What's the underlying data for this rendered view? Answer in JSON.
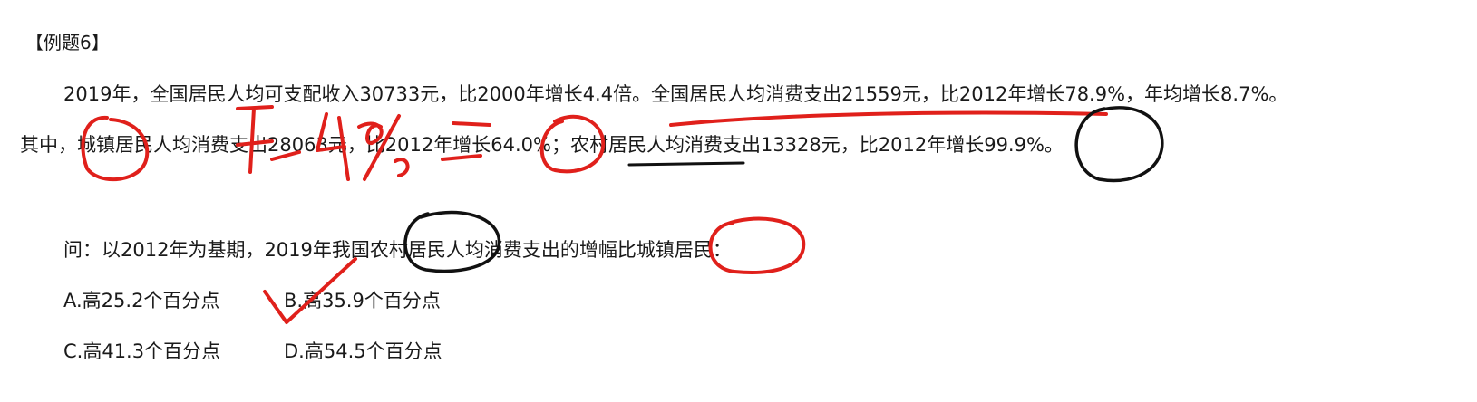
{
  "problem": {
    "title": "【例题6】",
    "paragraph1": "2019年，全国居民人均可支配收入30733元，比2000年增长4.4倍。全国居民人均消费支出21559元，比2012年增长78.9%，年均增长8.7%。",
    "paragraph2": "其中，城镇居民人均消费支出28063元，比2012年增长64.0%；农村居民人均消费支出13328元，比2012年增长99.9%。",
    "question": "问：以2012年为基期，2019年我国农村居民人均消费支出的增幅比城镇居民：",
    "options": {
      "a": "A.高25.2个百分点",
      "b": "B.高35.9个百分点",
      "c": "C.高41.3个百分点",
      "d": "D.高54.5个百分点"
    }
  },
  "annotations": {
    "handwritten_note": "差49%",
    "red_ink": "#e0201b",
    "black_ink": "#111111"
  }
}
